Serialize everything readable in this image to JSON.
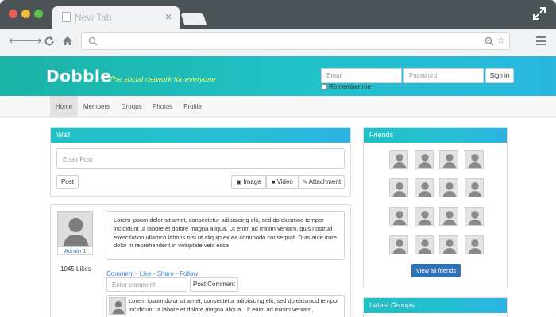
{
  "browser": {
    "tab_title": "New Tab",
    "tab_close": "×"
  },
  "site": {
    "logo": "Dobble",
    "tagline": "The social network for everyone",
    "login": {
      "email_placeholder": "Email",
      "password_placeholder": "Password",
      "signin_label": "Sign in",
      "remember_label": "Remember me"
    },
    "nav": [
      {
        "label": "Home"
      },
      {
        "label": "Members"
      },
      {
        "label": "Groups"
      },
      {
        "label": "Photos"
      },
      {
        "label": "Profile"
      }
    ]
  },
  "wall": {
    "title": "Wall",
    "post_placeholder": "Enter Post",
    "post_button": "Post",
    "image_button": "Image",
    "video_button": "Video",
    "attachment_button": "Attachment",
    "post": {
      "author": "Admin 1",
      "likes": "1045 Likes",
      "text": "Lorem ipsum dolor sit amet, consectetur adipisicing elit, sed do eiusmod tempor incididunt ut labore et dolore magna aliqua. Ut enim ad minim veniam, quis nostrud exercitation ullamco laboris nisi ut aliquip ex ea commodo consequat. Duis aute irure dolor in reprehenderit in voluptate velit esse",
      "actions": {
        "comment": "Comment",
        "like": "Like",
        "share": "Share",
        "follow": "Follow",
        "separator": " - "
      },
      "comment_placeholder": "Enter comment",
      "comment_button": "Post Comment",
      "comment_text": "Lorem ipsum dolor sit amet, consectetur adipisicing elit, sed do eiusmod tempor incididunt ut labore et dolore magna aliqua. Ut enim ad minim veniam,"
    }
  },
  "friends": {
    "title": "Friends",
    "view_all": "View all friends",
    "count": 16
  },
  "latest_groups": {
    "title": "Latest Groups"
  },
  "colors": {
    "header_gradient_start": "#1bb3a6",
    "header_gradient_end": "#29b6df",
    "tagline": "#e9f96b",
    "link": "#3a7bbf",
    "primary_button": "#2f72b5"
  }
}
